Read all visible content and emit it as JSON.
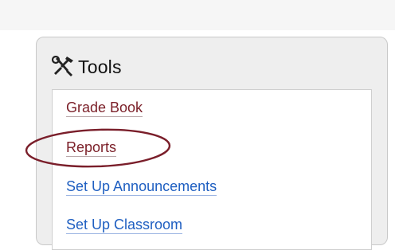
{
  "panel": {
    "title": "Tools",
    "icon": "hammer-wrench-icon"
  },
  "links": [
    {
      "label": "Grade Book",
      "style": "visited"
    },
    {
      "label": "Reports",
      "style": "visited",
      "highlighted": true
    },
    {
      "label": "Set Up Announcements",
      "style": "unvisited"
    },
    {
      "label": "Set Up Classroom",
      "style": "unvisited"
    }
  ],
  "colors": {
    "visited_link": "#7b1f28",
    "unvisited_link": "#1f5fc1",
    "highlight_ellipse": "#7a1e2a",
    "panel_bg": "#eeeeee"
  }
}
